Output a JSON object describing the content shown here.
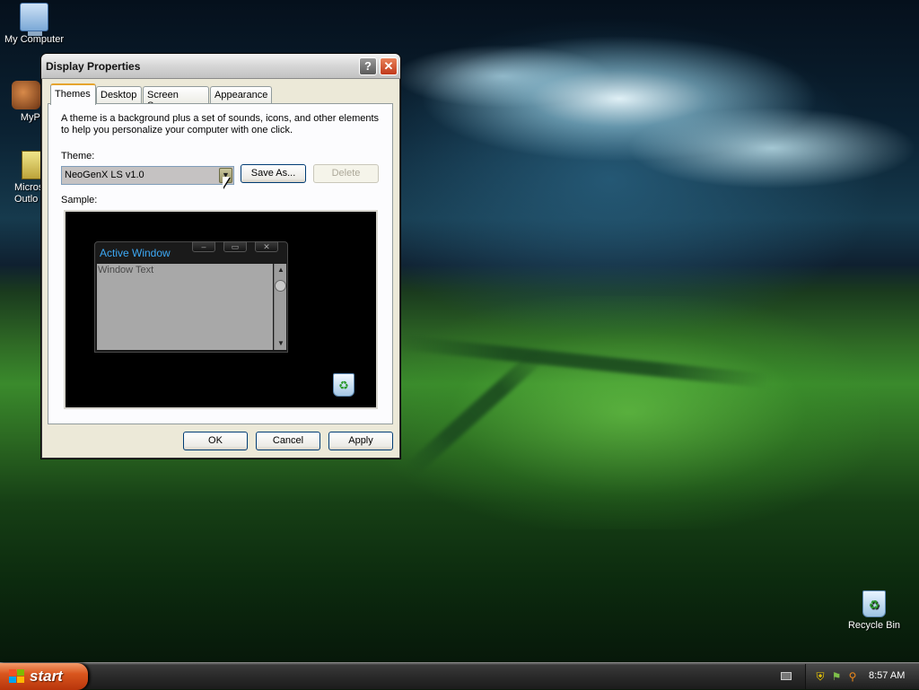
{
  "desktop": {
    "icons": [
      {
        "label": "My Computer",
        "icon": "computer-icon"
      },
      {
        "label": "MyPa",
        "icon": "mypa-icon"
      },
      {
        "label": "Micros Outlo",
        "icon": "outlook-icon"
      },
      {
        "label": "Recycle Bin",
        "icon": "recycle-bin-icon"
      }
    ]
  },
  "window": {
    "title": "Display Properties",
    "help_label": "?",
    "close_label": "✕",
    "tabs": [
      {
        "label": "Themes",
        "active": true
      },
      {
        "label": "Desktop",
        "active": false
      },
      {
        "label": "Screen Saver",
        "active": false
      },
      {
        "label": "Appearance",
        "active": false
      }
    ],
    "themes": {
      "description": "A theme is a background plus a set of sounds, icons, and other elements to help you personalize your computer with one click.",
      "theme_label": "Theme:",
      "theme_selected": "NeoGenX LS v1.0",
      "save_as_label": "Save As...",
      "delete_label": "Delete",
      "sample_label": "Sample:",
      "sample": {
        "active_window_title": "Active Window",
        "window_text": "Window Text"
      }
    },
    "buttons": {
      "ok": "OK",
      "cancel": "Cancel",
      "apply": "Apply"
    }
  },
  "taskbar": {
    "start_label": "start",
    "clock": "8:57 AM"
  },
  "colors": {
    "accent_active_window": "#3da9f5",
    "start_button": "#d9561e"
  }
}
